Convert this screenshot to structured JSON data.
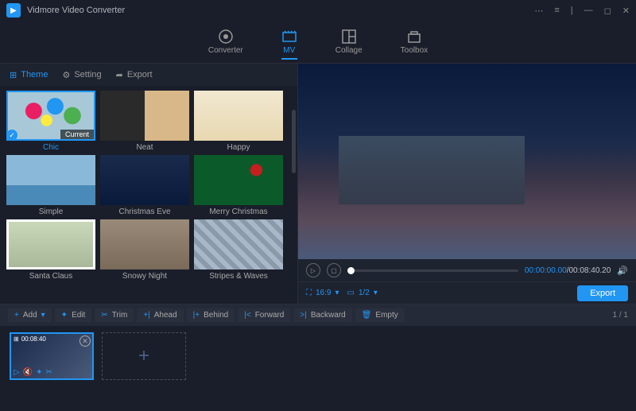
{
  "app": {
    "title": "Vidmore Video Converter"
  },
  "nav": {
    "converter": "Converter",
    "mv": "MV",
    "collage": "Collage",
    "toolbox": "Toolbox"
  },
  "subtabs": {
    "theme": "Theme",
    "setting": "Setting",
    "export": "Export"
  },
  "themes": [
    {
      "label": "Chic",
      "current": "Current",
      "selected": true
    },
    {
      "label": "Neat"
    },
    {
      "label": "Happy"
    },
    {
      "label": "Simple"
    },
    {
      "label": "Christmas Eve"
    },
    {
      "label": "Merry Christmas"
    },
    {
      "label": "Santa Claus"
    },
    {
      "label": "Snowy Night"
    },
    {
      "label": "Stripes & Waves"
    }
  ],
  "player": {
    "time_current": "00:00:00.00",
    "time_total": "/00:08:40.20",
    "aspect": "16:9",
    "frame_current": "1/2"
  },
  "export_btn": "Export",
  "toolbar": {
    "add": "Add",
    "edit": "Edit",
    "trim": "Trim",
    "ahead": "Ahead",
    "behind": "Behind",
    "forward": "Forward",
    "backward": "Backward",
    "empty": "Empty",
    "page": "1 / 1"
  },
  "clip": {
    "duration": "00:08:40"
  }
}
